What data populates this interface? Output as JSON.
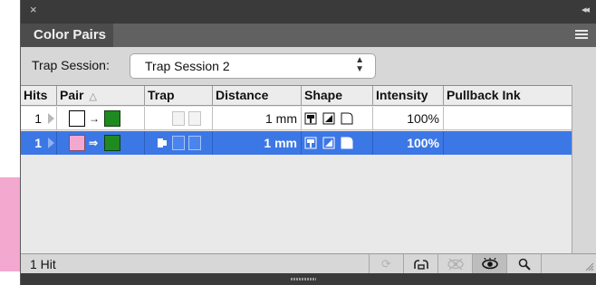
{
  "panel": {
    "close_glyph": "×",
    "collapse_glyph": "◂◂",
    "tab_label": "Color Pairs",
    "menu_icon": "panel-menu-icon"
  },
  "session": {
    "label": "Trap Session:",
    "value": "Trap Session 2"
  },
  "table": {
    "columns": [
      "Hits",
      "Pair",
      "Trap",
      "Distance",
      "Shape",
      "Intensity",
      "Pullback Ink"
    ],
    "rows": [
      {
        "hits": "1",
        "pair_from": "white",
        "pair_to": "green",
        "pair_arrow": "→",
        "distance": "1 mm",
        "intensity": "100%",
        "pullback_ink": "",
        "selected": false
      },
      {
        "hits": "1",
        "pair_from": "pink",
        "pair_to": "green",
        "pair_arrow": "⇒",
        "distance": "1 mm",
        "intensity": "100%",
        "pullback_ink": "",
        "selected": true
      }
    ]
  },
  "footer": {
    "hits_text": "1 Hit",
    "buttons": [
      "refresh-icon",
      "link-icon",
      "hide-icon",
      "eye-icon",
      "magnify-icon"
    ]
  },
  "colors": {
    "selection": "#3c77e6",
    "pink": "#f3a8cf",
    "green": "#1f8a1f",
    "panel_bg": "#d7d7d7",
    "titlebar": "#3a3a3a"
  }
}
